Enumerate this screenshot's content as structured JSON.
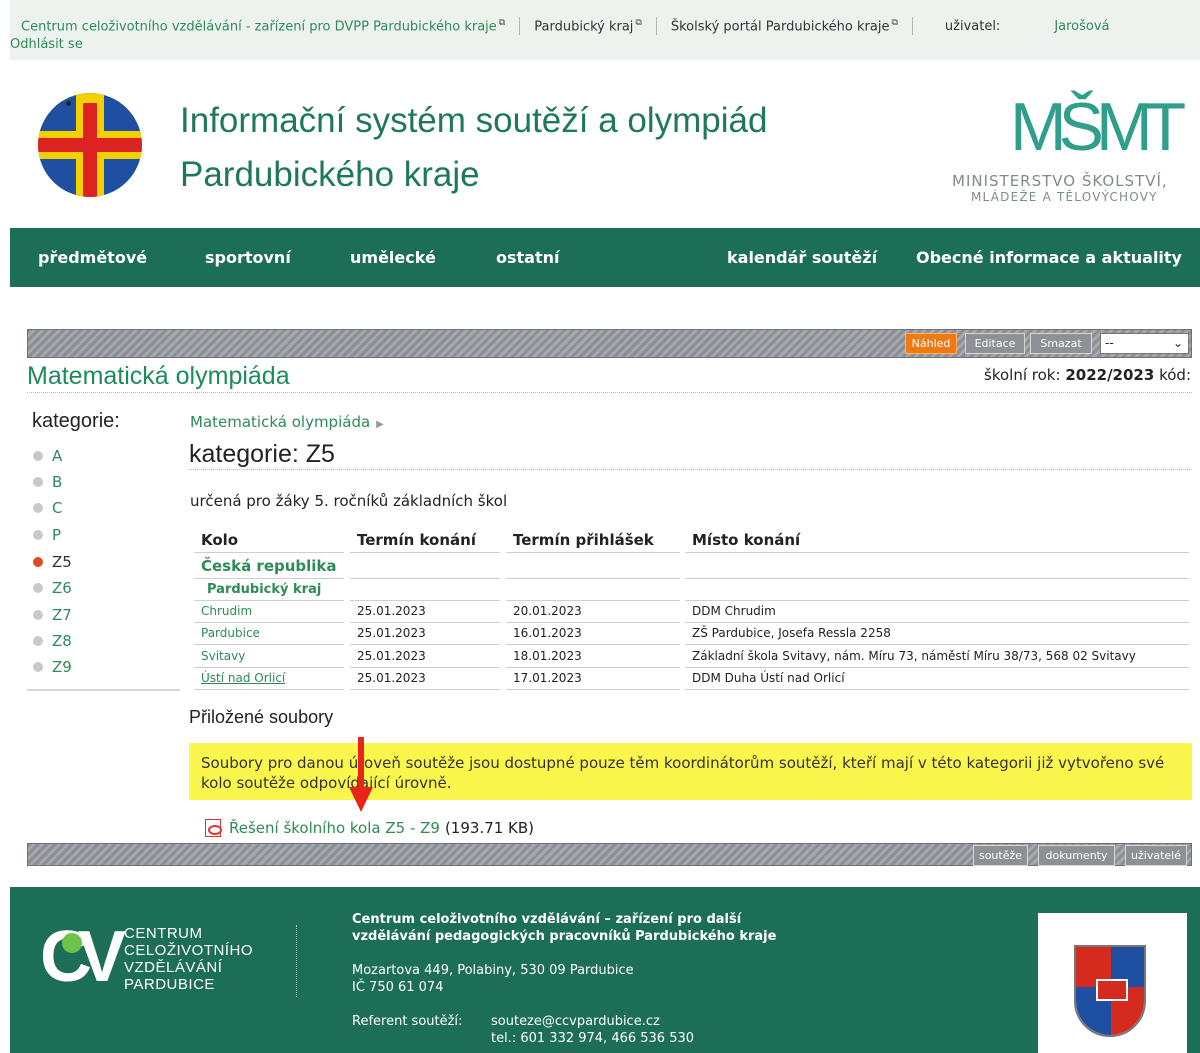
{
  "topbar": {
    "link_ccv": "Centrum celoživotního vzdělávání - zařízení pro DVPP Pardubického kraje",
    "link_kraj": "Pardubický kraj",
    "link_portal": "Školský portál Pardubického kraje",
    "user_label": "uživatel:",
    "user_name": "Jarošová",
    "logout": "Odhlásit se",
    "ext_glyph": "⧉"
  },
  "header": {
    "title_line1": "Informační systém soutěží a olympiád",
    "title_line2": "Pardubického kraje",
    "msmt_monogram": "MŠMT",
    "msmt_line1": "MINISTERSTVO ŠKOLSTVÍ,",
    "msmt_line2": "MLÁDEŽE A TĚLOVÝCHOVY"
  },
  "nav": {
    "items": [
      "předmětové",
      "sportovní",
      "umělecké",
      "ostatní",
      "kalendář soutěží",
      "Obecné informace a aktuality"
    ]
  },
  "toolbar": {
    "preview": "Náhled",
    "edit": "Editace",
    "delete": "Smazat",
    "select_value": "--"
  },
  "page": {
    "heading": "Matematická olympiáda",
    "school_year_label": "školní rok:",
    "school_year_value": "2022/2023",
    "code_label": "kód:"
  },
  "sidebar": {
    "title": "kategorie:",
    "categories": [
      "A",
      "B",
      "C",
      "P",
      "Z5",
      "Z6",
      "Z7",
      "Z8",
      "Z9"
    ],
    "active": "Z5"
  },
  "main": {
    "breadcrumb": "Matematická olympiáda",
    "category_title": "kategorie: Z5",
    "category_desc": "určená pro žáky 5. ročníků základních škol",
    "table": {
      "headers": [
        "Kolo",
        "Termín konání",
        "Termín přihlášek",
        "Místo konání"
      ],
      "group": "Česká republika",
      "subgroup": "Pardubický kraj",
      "rows": [
        {
          "kolo": "Chrudim",
          "termin": "25.01.2023",
          "prihlasky": "20.01.2023",
          "misto": "DDM Chrudim"
        },
        {
          "kolo": "Pardubice",
          "termin": "25.01.2023",
          "prihlasky": "16.01.2023",
          "misto": "ZŠ Pardubice, Josefa Ressla 2258"
        },
        {
          "kolo": "Svitavy",
          "termin": "25.01.2023",
          "prihlasky": "18.01.2023",
          "misto": "Základní škola Svitavy, nám. Míru 73, náměstí Míru 38/73, 568 02 Svitavy"
        },
        {
          "kolo": "Ústí nad Orlicí",
          "termin": "25.01.2023",
          "prihlasky": "17.01.2023",
          "misto": "DDM Duha Ústí nad Orlicí"
        }
      ]
    },
    "files_title": "Přiložené soubory",
    "notice": "Soubory pro danou úroveň soutěže jsou dostupné pouze těm koordinátorům soutěží, kteří mají v této kategorii již vytvořeno své kolo soutěže odpovídající úrovně.",
    "file_name": "Řešení školního kola Z5 - Z9",
    "file_size": "(193.71 KB)"
  },
  "bottombar": {
    "competitions": "soutěže",
    "documents": "dokumenty",
    "users": "uživatelé"
  },
  "footer": {
    "cv_letters": "CV",
    "cv_line1": "CENTRUM",
    "cv_line2": "CELOŽIVOTNÍHO",
    "cv_line3": "VZDĚLÁVÁNÍ",
    "cv_line4": "PARDUBICE",
    "org_line1": "Centrum celoživotního vzdělávání – zařízení pro další",
    "org_line2": "vzdělávání pedagogických pracovníků Pardubického kraje",
    "address": "Mozartova 449, Polabiny, 530 09 Pardubice",
    "ico": "IČ 750 61 074",
    "referent_label": "Referent soutěží:",
    "referent_email": "souteze@ccvpardubice.cz",
    "referent_phone": "tel.: 601 332 974, 466 536 530"
  },
  "colors": {
    "brand_green": "#1d6e56",
    "link_green": "#2e8b57",
    "notice_yellow": "#fbf64c",
    "preview_orange": "#ef7a14",
    "active_bullet": "#e1491e",
    "arrow_red": "#e8251b"
  }
}
